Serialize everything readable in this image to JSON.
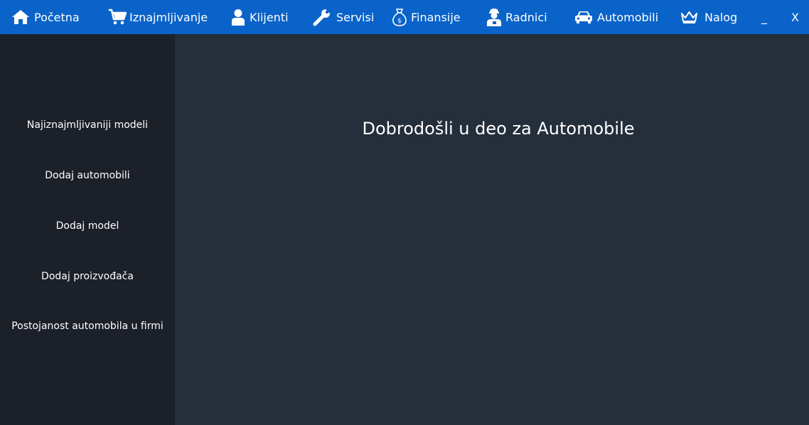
{
  "topbar": {
    "bg_color": "#0a63c9",
    "items": [
      {
        "label": "Početna",
        "icon": "home-icon"
      },
      {
        "label": "Iznajmljivanje",
        "icon": "cart-icon"
      },
      {
        "label": "Klijenti",
        "icon": "user-icon"
      },
      {
        "label": "Servisi",
        "icon": "wrench-icon"
      },
      {
        "label": "Finansije",
        "icon": "money-bag-icon"
      },
      {
        "label": "Radnici",
        "icon": "worker-icon"
      },
      {
        "label": "Automobili",
        "icon": "car-icon"
      },
      {
        "label": "Nalog",
        "icon": "crown-icon"
      }
    ],
    "minimize_label": "_",
    "close_label": "X"
  },
  "sidebar": {
    "bg_color": "#1c2029",
    "items": [
      {
        "label": "Najiznajmljivaniji modeli"
      },
      {
        "label": "Dodaj automobili"
      },
      {
        "label": "Dodaj model"
      },
      {
        "label": "Dodaj proizvođača"
      },
      {
        "label": "Postojanost automobila u firmi"
      }
    ]
  },
  "main": {
    "bg_color": "#252e3b",
    "welcome_text": "Dobrodošli u deo za Automobile"
  }
}
